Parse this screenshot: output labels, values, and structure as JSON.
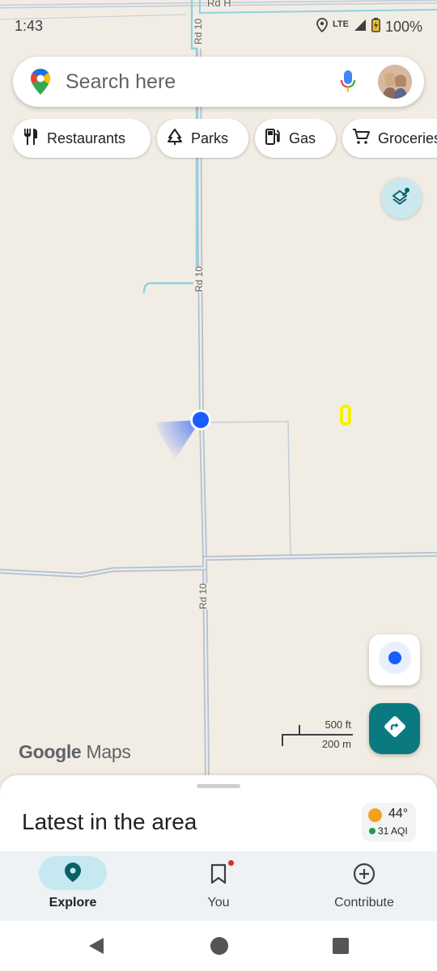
{
  "status_bar": {
    "time": "1:43",
    "network": "LTE",
    "battery": "100%"
  },
  "search": {
    "placeholder": "Search here"
  },
  "chips": [
    {
      "label": "Restaurants",
      "icon": "fork-knife-icon"
    },
    {
      "label": "Parks",
      "icon": "tree-icon"
    },
    {
      "label": "Gas",
      "icon": "gas-pump-icon"
    },
    {
      "label": "Groceries",
      "icon": "cart-icon"
    }
  ],
  "map": {
    "road_labels": [
      "Rd H",
      "Rd 10",
      "Rd 10",
      "Rd 10"
    ],
    "scale": {
      "imperial": "500 ft",
      "metric": "200 m"
    },
    "watermark_google": "Google",
    "watermark_maps": "Maps"
  },
  "sheet": {
    "title": "Latest in the area",
    "weather": {
      "temp": "44°",
      "aqi": "31 AQI"
    }
  },
  "bottom_nav": [
    {
      "label": "Explore",
      "icon": "location-pin-icon",
      "active": true
    },
    {
      "label": "You",
      "icon": "bookmark-icon",
      "active": false
    },
    {
      "label": "Contribute",
      "icon": "add-circle-icon",
      "active": false
    }
  ],
  "colors": {
    "accent": "#0b7a80",
    "location_dot": "#1a5cff",
    "map_bg": "#f2ede4",
    "nav_active_pill": "#c6e9f1"
  }
}
